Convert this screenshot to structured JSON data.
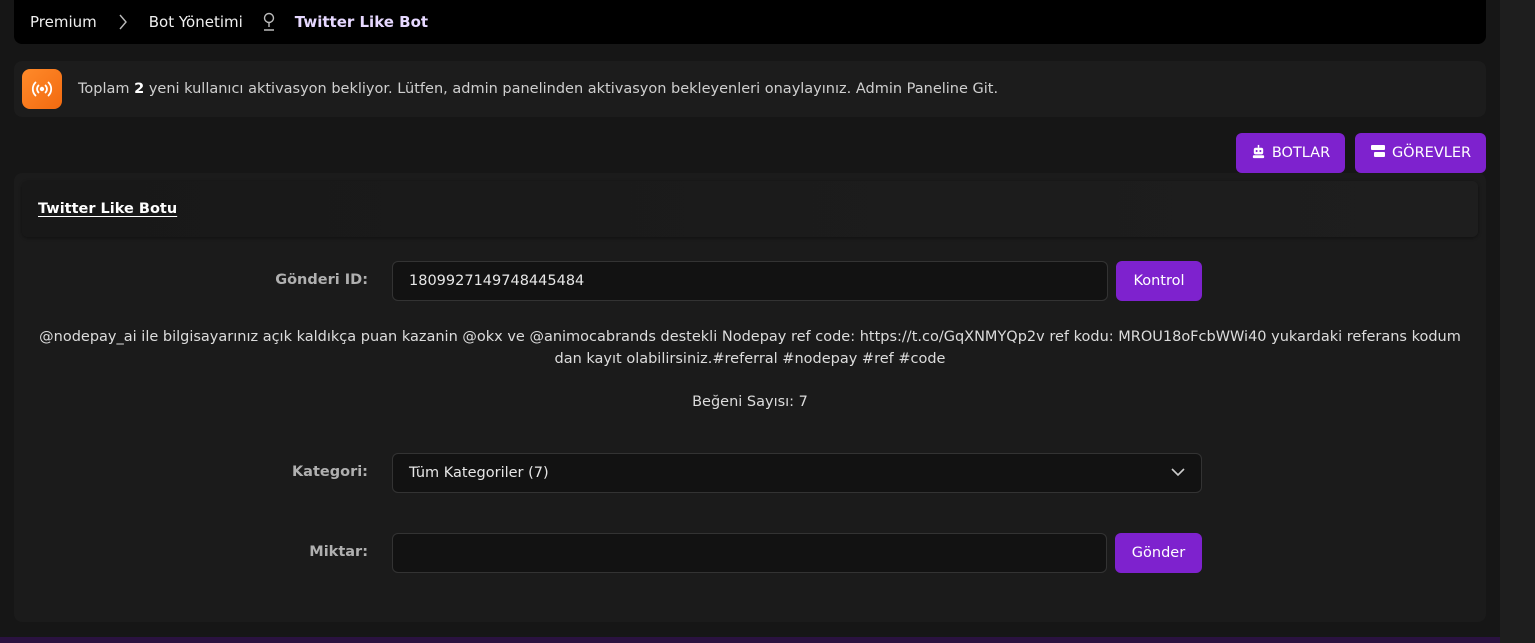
{
  "breadcrumb": {
    "items": [
      "Premium",
      "Bot Yönetimi"
    ],
    "active": "Twitter Like Bot"
  },
  "alert": {
    "prefix": "Toplam ",
    "count": "2",
    "suffix": " yeni kullanıcı aktivasyon bekliyor. Lütfen, admin panelinden aktivasyon bekleyenleri onaylayınız. Admin Paneline Git.",
    "icon": "broadcast-icon",
    "color": "#f47a1f"
  },
  "toolbar": {
    "bots_label": "BOTLAR",
    "tasks_label": "GÖREVLER",
    "accent": "#7e22ce"
  },
  "card": {
    "title": "Twitter Like Botu"
  },
  "form": {
    "post_id_label": "Gönderi ID:",
    "post_id_value": "1809927149748445484",
    "check_label": "Kontrol",
    "tweet_text": "@nodepay_ai ile bilgisayarınız açık kaldıkça puan kazanin @okx ve @animocabrands destekli Nodepay ref code: https://t.co/GqXNMYQp2v ref kodu: MROU18oFcbWWi40 yukardaki referans kodum dan kayıt olabilirsiniz.#referral #nodepay #ref #code",
    "like_count": "Beğeni Sayısı: 7",
    "category_label": "Kategori:",
    "category_selected": "Tüm Kategoriler (7)",
    "amount_label": "Miktar:",
    "amount_value": "",
    "send_label": "Gönder"
  }
}
